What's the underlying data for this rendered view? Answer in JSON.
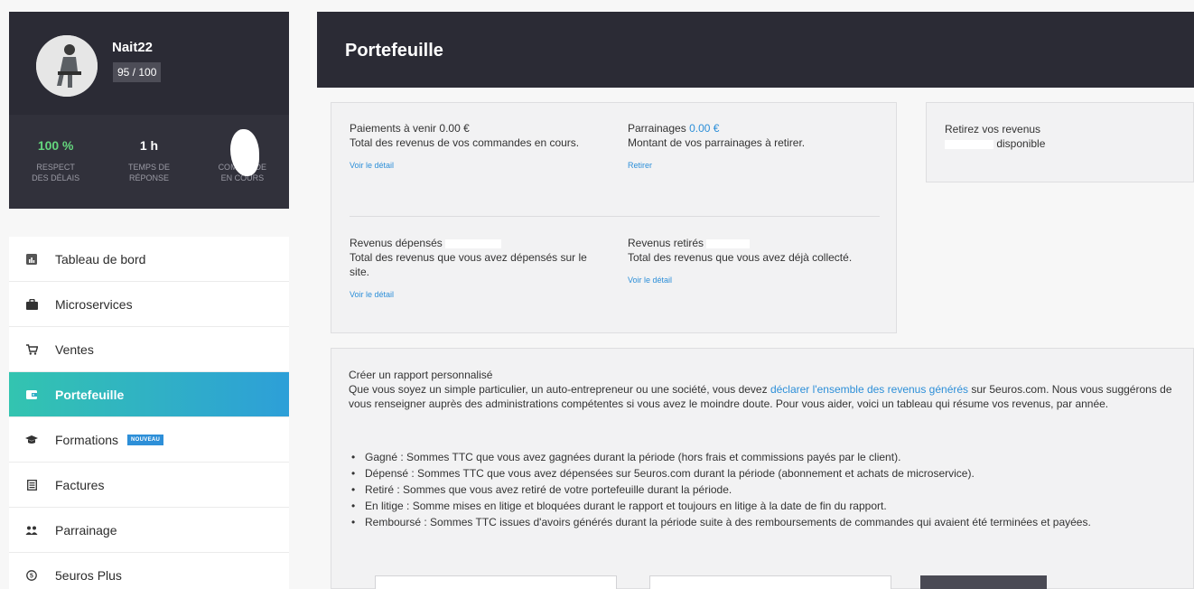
{
  "profile": {
    "username": "Nait22",
    "score": "95 / 100",
    "stats": [
      {
        "value": "100 %",
        "label1": "RESPECT",
        "label2": "DES DÉLAIS"
      },
      {
        "value": "1 h",
        "label1": "TEMPS DE",
        "label2": "RÉPONSE"
      },
      {
        "value": "",
        "label1": "COMMANDE",
        "label2": "EN COURS"
      }
    ]
  },
  "nav": {
    "items": [
      {
        "label": "Tableau de bord",
        "icon": "dashboard-icon"
      },
      {
        "label": "Microservices",
        "icon": "briefcase-icon"
      },
      {
        "label": "Ventes",
        "icon": "cart-icon"
      },
      {
        "label": "Portefeuille",
        "icon": "wallet-icon"
      },
      {
        "label": "Formations",
        "icon": "graduation-cap-icon",
        "badge": "NOUVEAU"
      },
      {
        "label": "Factures",
        "icon": "invoice-icon"
      },
      {
        "label": "Parrainage",
        "icon": "users-icon"
      },
      {
        "label": "5euros Plus",
        "icon": "plus-circle-icon"
      }
    ]
  },
  "header": {
    "title": "Portefeuille"
  },
  "summary": {
    "upcoming": {
      "title": "Paiements à venir",
      "amount": "0.00 €",
      "desc": "Total des revenus de vos commandes en cours.",
      "link": "Voir le détail"
    },
    "referrals": {
      "title": "Parrainages",
      "amount": "0.00 €",
      "desc": "Montant de vos parrainages à retirer.",
      "link": "Retirer"
    },
    "spent": {
      "title": "Revenus dépensés",
      "desc": "Total des revenus que vous avez dépensés sur le site.",
      "link": "Voir le détail"
    },
    "withdrawn": {
      "title": "Revenus retirés",
      "desc": "Total des revenus que vous avez déjà collecté.",
      "link": "Voir le détail"
    }
  },
  "withdraw": {
    "title": "Retirez vos revenus",
    "available": "disponible"
  },
  "report": {
    "title": "Créer un rapport personnalisé",
    "para_before": "Que vous soyez un simple particulier, un auto-entrepreneur ou une société, vous devez ",
    "para_link": "déclarer l'ensemble des revenus générés",
    "para_after": " sur 5euros.com. Nous vous suggérons de vous renseigner auprès des administrations compétentes si vous avez le moindre doute. Pour vous aider, voici un tableau qui résume vos revenus, par année.",
    "bullets": [
      "Gagné : Sommes TTC que vous avez gagnées durant la période (hors frais et commissions payés par le client).",
      "Dépensé : Sommes TTC que vous avez dépensées sur 5euros.com durant la période (abonnement et achats de microservice).",
      "Retiré : Sommes que vous avez retiré de votre portefeuille durant la période.",
      "En litige : Somme mises en litige et bloquées durant le rapport et toujours en litige à la date de fin du rapport.",
      "Remboursé : Sommes TTC issues d'avoirs générés durant la période suite à des remboursements de commandes qui avaient été terminées et payées."
    ]
  }
}
